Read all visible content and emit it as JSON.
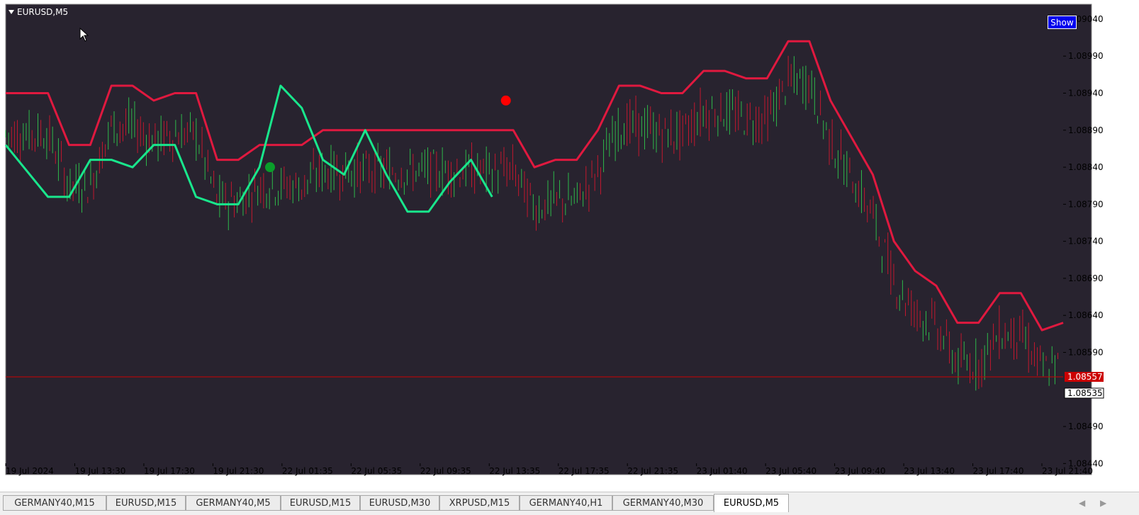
{
  "chart_data": {
    "type": "candlestick",
    "symbol_label": "EURUSD,M5",
    "show_button_label": "Show",
    "y_ticks": [
      "1.09040",
      "1.08990",
      "1.08940",
      "1.08890",
      "1.08840",
      "1.08790",
      "1.08740",
      "1.08690",
      "1.08640",
      "1.08590",
      "1.08490",
      "1.08440"
    ],
    "y_tick_values": [
      1.0904,
      1.0899,
      1.0894,
      1.0889,
      1.0884,
      1.0879,
      1.0874,
      1.0869,
      1.0864,
      1.0859,
      1.0849,
      1.0844
    ],
    "ylim": [
      1.08425,
      1.0906
    ],
    "x_ticks": [
      "19 Jul 2024",
      "19 Jul 13:30",
      "19 Jul 17:30",
      "19 Jul 21:30",
      "22 Jul 01:35",
      "22 Jul 05:35",
      "22 Jul 09:35",
      "22 Jul 13:35",
      "22 Jul 17:35",
      "22 Jul 21:35",
      "23 Jul 01:40",
      "23 Jul 05:40",
      "23 Jul 09:40",
      "23 Jul 13:40",
      "23 Jul 17:40",
      "23 Jul 21:40"
    ],
    "current_price_label": "1.08557",
    "current_price": 1.08557,
    "bid_label": "1.08535",
    "bid_price": 1.08535,
    "grid": false,
    "colors": {
      "background": "#28232f",
      "upper_band": "#e0193f",
      "lower_band": "#19e68c",
      "trend_line_bear": "#e0193f",
      "trend_line_bull": "#19e68c",
      "candles_up": "#2eb84a",
      "candles_down": "#c2182f",
      "price_line": "#cc0000",
      "buy_signal": "#0a9e2a",
      "sell_signal": "#ff0000",
      "marker": "#f5a623"
    },
    "series": [
      {
        "type": "upper_band",
        "x": [
          0,
          4,
          6,
          8,
          10,
          12,
          14,
          16,
          18,
          20,
          22,
          24,
          26,
          28,
          30,
          32,
          34,
          36,
          38,
          40,
          42,
          44,
          46,
          48,
          50,
          52,
          54,
          56,
          58,
          60,
          62,
          64,
          66,
          68,
          70,
          72,
          74,
          76,
          78,
          80,
          82,
          84,
          86,
          88,
          90,
          92,
          94,
          96,
          98,
          100
        ],
        "values": [
          1.0894,
          1.0894,
          1.0887,
          1.0887,
          1.0895,
          1.0895,
          1.0893,
          1.0894,
          1.0894,
          1.0885,
          1.0885,
          1.0887,
          1.0887,
          1.0887,
          1.0889,
          1.0889,
          1.0889,
          1.0889,
          1.0889,
          1.0889,
          1.0889,
          1.0889,
          1.0889,
          1.0889,
          1.0884,
          1.0885,
          1.0885,
          1.0889,
          1.0895,
          1.0895,
          1.0894,
          1.0894,
          1.0897,
          1.0897,
          1.0896,
          1.0896,
          1.0901,
          1.0901,
          1.0893,
          1.0888,
          1.0883,
          1.0874,
          1.087,
          1.0868,
          1.0863,
          1.0863,
          1.0867,
          1.0867,
          1.0862,
          1.0863
        ]
      },
      {
        "type": "lower_band",
        "x": [
          0,
          4,
          6,
          8,
          10,
          12,
          14,
          16,
          18,
          20,
          22,
          24,
          26,
          28,
          30,
          32,
          34,
          36,
          38,
          40,
          42,
          44,
          46
        ],
        "values": [
          1.0887,
          1.088,
          1.088,
          1.0885,
          1.0885,
          1.0884,
          1.0887,
          1.0887,
          1.088,
          1.0879,
          1.0879,
          1.0884,
          1.0895,
          1.0892,
          1.0885,
          1.0883,
          1.0889,
          1.0883,
          1.0878,
          1.0878,
          1.0882,
          1.0885,
          1.088
        ]
      }
    ],
    "signals": [
      {
        "type": "buy",
        "price": 1.0884
      },
      {
        "type": "sell",
        "price": 1.0893
      }
    ]
  },
  "tabs": [
    {
      "label": "GERMANY40,M15"
    },
    {
      "label": "EURUSD,M15"
    },
    {
      "label": "GERMANY40,M5"
    },
    {
      "label": "EURUSD,M15"
    },
    {
      "label": "EURUSD,M30"
    },
    {
      "label": "XRPUSD,M15"
    },
    {
      "label": "GERMANY40,H1"
    },
    {
      "label": "GERMANY40,M30"
    },
    {
      "label": "EURUSD,M5"
    }
  ],
  "active_tab_index": 8,
  "tab_scroll": {
    "left": "◀",
    "right": "▶"
  }
}
